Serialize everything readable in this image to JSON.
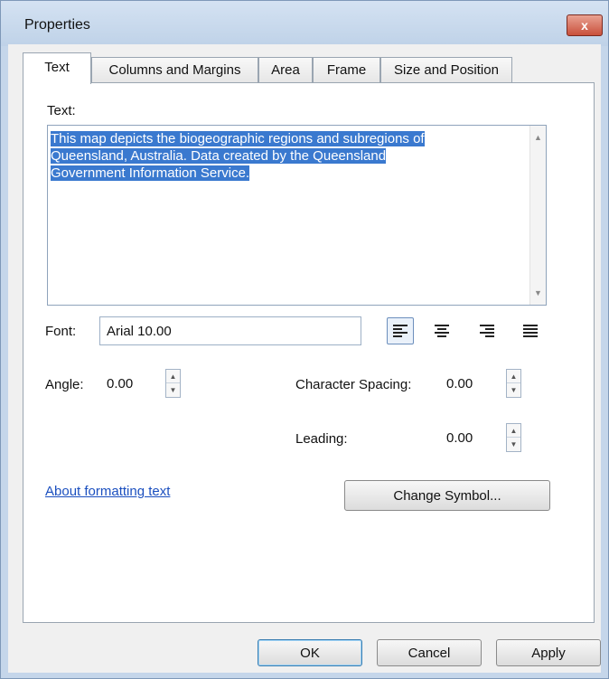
{
  "window": {
    "title": "Properties",
    "close_label": "x"
  },
  "tabs": [
    {
      "label": "Text",
      "active": true
    },
    {
      "label": "Columns and Margins",
      "active": false
    },
    {
      "label": "Area",
      "active": false
    },
    {
      "label": "Frame",
      "active": false
    },
    {
      "label": "Size and Position",
      "active": false
    }
  ],
  "text_section": {
    "label": "Text:",
    "lines": [
      "This map depicts the biogeographic regions and subregions of",
      "Queensland, Australia. Data created by the Queensland",
      "Government Information Service."
    ]
  },
  "font": {
    "label": "Font:",
    "value": "Arial 10.00"
  },
  "alignment": {
    "selected": "left",
    "options": [
      {
        "name": "align-left-icon"
      },
      {
        "name": "align-center-icon"
      },
      {
        "name": "align-right-icon"
      },
      {
        "name": "align-justify-icon"
      }
    ]
  },
  "angle": {
    "label": "Angle:",
    "value": "0.00"
  },
  "character_spacing": {
    "label": "Character Spacing:",
    "value": "0.00"
  },
  "leading": {
    "label": "Leading:",
    "value": "0.00"
  },
  "about_link": "About formatting text",
  "change_symbol_label": "Change Symbol...",
  "footer": {
    "ok_label": "OK",
    "cancel_label": "Cancel",
    "apply_label": "Apply"
  },
  "colors": {
    "selection": "#3a79cf",
    "link": "#1b4fbf",
    "close_button": "#c9503b"
  }
}
